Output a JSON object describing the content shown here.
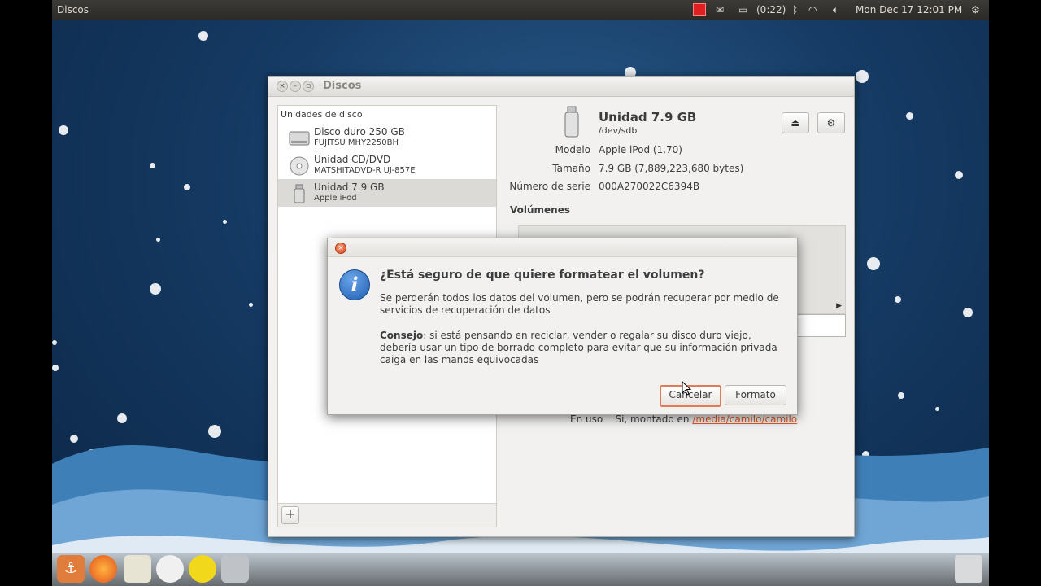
{
  "topbar": {
    "app_name": "Discos",
    "battery_time": "(0:22)",
    "clock": "Mon Dec 17  12:01 PM"
  },
  "window": {
    "title": "Discos",
    "drives_header": "Unidades de disco",
    "drives": [
      {
        "name": "Disco duro 250 GB",
        "sub": "FUJITSU MHY2250BH",
        "icon": "hdd-icon"
      },
      {
        "name": "Unidad CD/DVD",
        "sub": "MATSHITADVD-R   UJ-857E",
        "icon": "optical-disc-icon"
      },
      {
        "name": "Unidad 7.9 GB",
        "sub": "Apple iPod",
        "icon": "usb-drive-icon",
        "selected": true
      }
    ],
    "add_label": "+",
    "detail": {
      "title": "Unidad 7.9 GB",
      "device": "/dev/sdb",
      "props": [
        {
          "label": "Modelo",
          "value": "Apple iPod (1.70)"
        },
        {
          "label": "Tamaño",
          "value": "7.9 GB (7,889,223,680 bytes)"
        },
        {
          "label": "Número de serie",
          "value": "000A270022C6394B"
        }
      ],
      "volumes_heading": "Volúmenes",
      "in_use_label": "En uso",
      "in_use_value": "Sí, montado en",
      "mount_path": "/media/camilo/camilo"
    }
  },
  "dialog": {
    "heading": "¿Está seguro de que quiere formatear el volumen?",
    "message": "Se perderán todos los datos del volumen, pero se podrán recuperar por medio de servicios de recuperación de datos",
    "tip_label": "Consejo",
    "tip_text": ": si está pensando en reciclar, vender o regalar su disco duro viejo, debería usar un tipo de borrado completo para evitar que su información privada caiga en las manos equivocadas",
    "cancel_label": "Cancelar",
    "format_label": "Formato"
  },
  "icons": {
    "info": "info-icon",
    "eject": "eject-icon",
    "settings": "gear-icon"
  }
}
